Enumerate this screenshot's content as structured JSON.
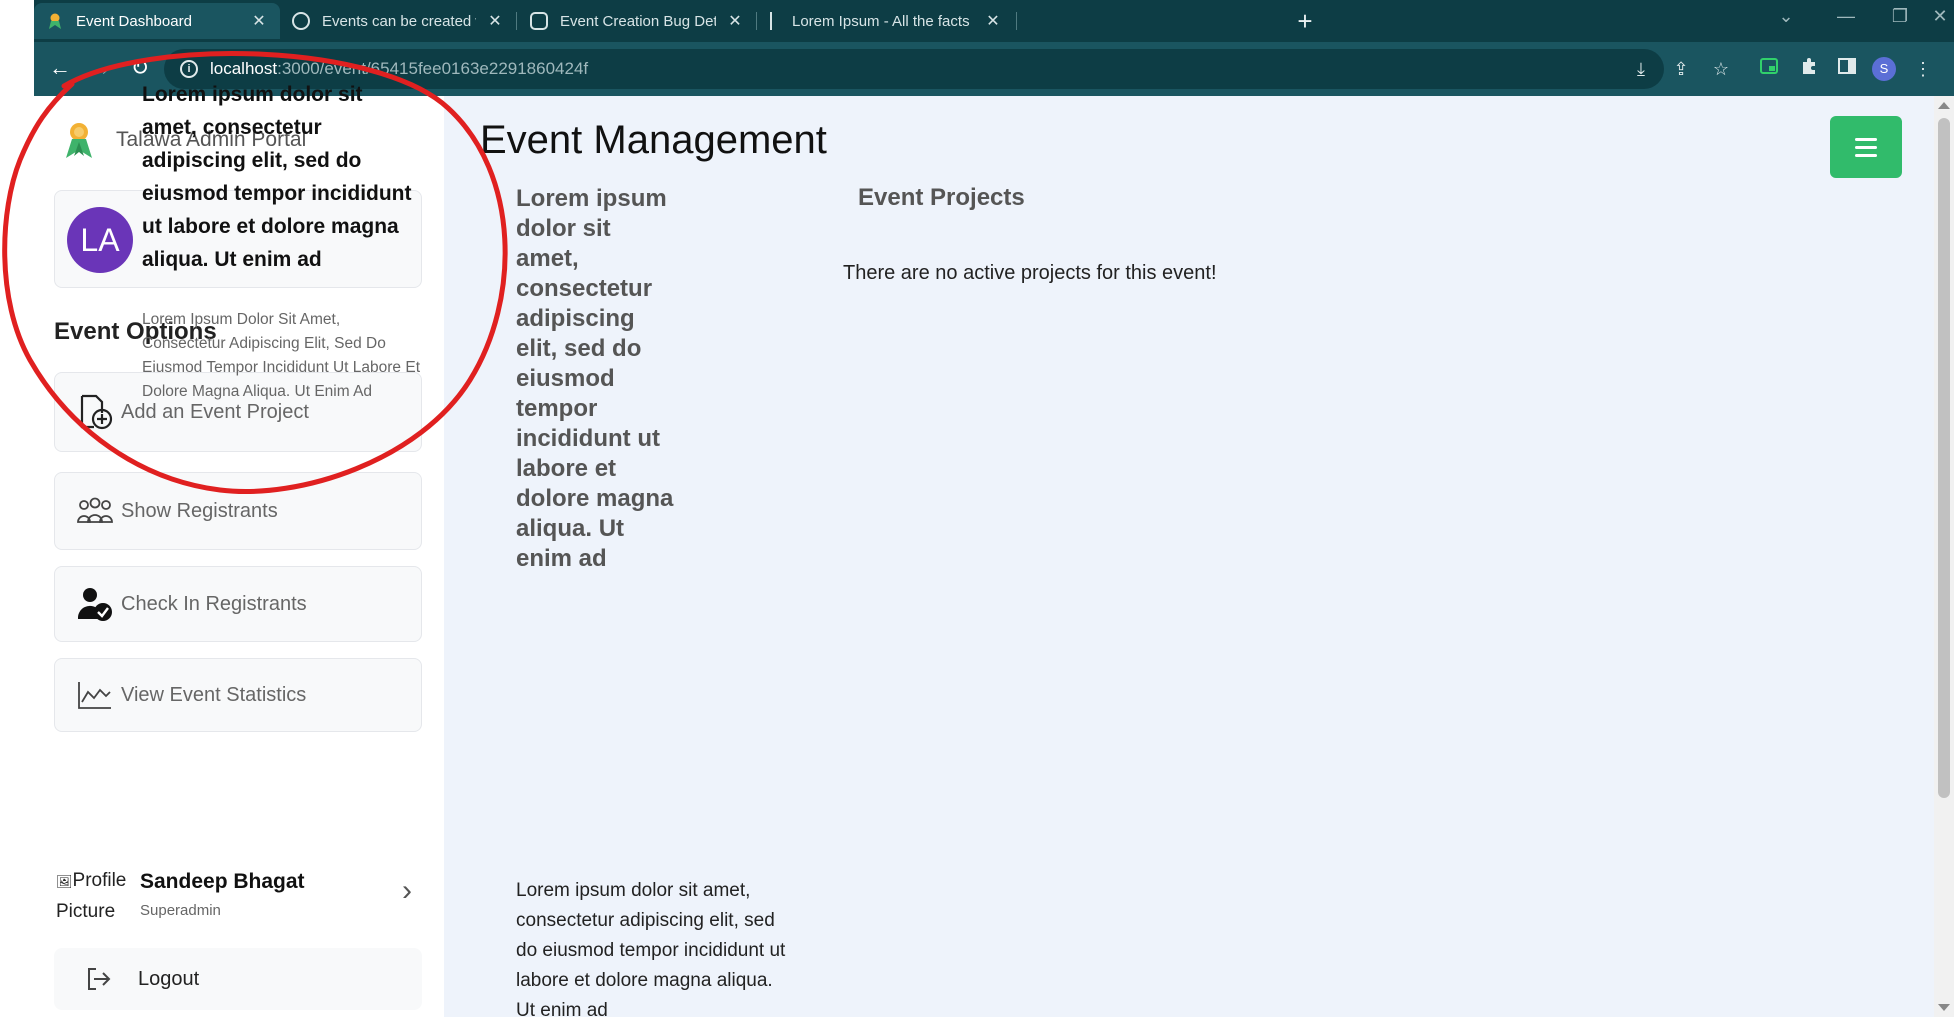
{
  "browser": {
    "tabs": [
      {
        "title": "Event Dashboard",
        "active": true
      },
      {
        "title": "Events can be created with blac",
        "active": false
      },
      {
        "title": "Event Creation Bug Detected",
        "active": false
      },
      {
        "title": "Lorem Ipsum - All the facts - Lip",
        "active": false
      }
    ],
    "url_host": "localhost",
    "url_path": ":3000/event/65415fee0163e2291860424f",
    "profile_initial": "S"
  },
  "sidebar": {
    "brand_title": "Talawa Admin Portal",
    "org": {
      "avatar_initials": "LA",
      "title": "Lorem ipsum dolor sit amet, consectetur adipiscing elit, sed do eiusmod tempor incididunt ut labore et dolore magna aliqua. Ut enim ad",
      "description": "Lorem Ipsum Dolor Sit Amet, Consectetur Adipiscing Elit, Sed Do Eiusmod Tempor Incididunt Ut Labore Et Dolore Magna Aliqua. Ut Enim Ad"
    },
    "section_heading": "Event Options",
    "options": [
      {
        "label": "Add an Event Project"
      },
      {
        "label": "Show Registrants"
      },
      {
        "label": "Check In Registrants"
      },
      {
        "label": "View Event Statistics"
      }
    ],
    "profile": {
      "picture_alt": "Profile Picture",
      "name": "Sandeep Bhagat",
      "role": "Superadmin"
    },
    "logout_label": "Logout"
  },
  "main": {
    "page_title": "Event Management",
    "event_title": "Lorem ipsum dolor sit amet, consectetur adipiscing elit, sed do eiusmod tempor incididunt ut labore et dolore magna aliqua. Ut enim ad",
    "event_description": "Lorem ipsum dolor sit amet, consectetur adipiscing elit, sed do eiusmod tempor incididunt ut labore et dolore magna aliqua. Ut enim ad",
    "projects_heading": "Event Projects",
    "projects_empty": "There are no active projects for this event!"
  },
  "colors": {
    "tabstrip": "#0d3d45",
    "toolbar": "#1a5560",
    "accent_green": "#31bb6b",
    "org_avatar": "#6a35b8",
    "annotation_red": "#e02020",
    "main_bg": "#eef3fb"
  }
}
